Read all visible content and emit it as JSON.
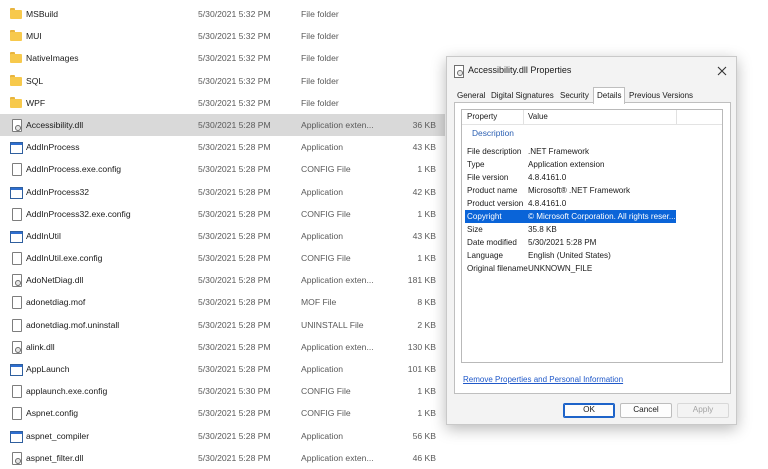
{
  "files": [
    {
      "icon": "folder-icon",
      "name": "MSBuild",
      "date": "5/30/2021 5:32 PM",
      "type": "File folder",
      "size": ""
    },
    {
      "icon": "folder-icon",
      "name": "MUI",
      "date": "5/30/2021 5:32 PM",
      "type": "File folder",
      "size": ""
    },
    {
      "icon": "folder-icon",
      "name": "NativeImages",
      "date": "5/30/2021 5:32 PM",
      "type": "File folder",
      "size": ""
    },
    {
      "icon": "folder-icon",
      "name": "SQL",
      "date": "5/30/2021 5:32 PM",
      "type": "File folder",
      "size": ""
    },
    {
      "icon": "folder-icon",
      "name": "WPF",
      "date": "5/30/2021 5:32 PM",
      "type": "File folder",
      "size": ""
    },
    {
      "icon": "dll-file-icon",
      "name": "Accessibility.dll",
      "date": "5/30/2021 5:28 PM",
      "type": "Application exten...",
      "size": "36 KB",
      "selected": true
    },
    {
      "icon": "application-icon",
      "name": "AddInProcess",
      "date": "5/30/2021 5:28 PM",
      "type": "Application",
      "size": "43 KB"
    },
    {
      "icon": "file-icon",
      "name": "AddInProcess.exe.config",
      "date": "5/30/2021 5:28 PM",
      "type": "CONFIG File",
      "size": "1 KB"
    },
    {
      "icon": "application-icon",
      "name": "AddInProcess32",
      "date": "5/30/2021 5:28 PM",
      "type": "Application",
      "size": "42 KB"
    },
    {
      "icon": "file-icon",
      "name": "AddInProcess32.exe.config",
      "date": "5/30/2021 5:28 PM",
      "type": "CONFIG File",
      "size": "1 KB"
    },
    {
      "icon": "application-icon",
      "name": "AddInUtil",
      "date": "5/30/2021 5:28 PM",
      "type": "Application",
      "size": "43 KB"
    },
    {
      "icon": "file-icon",
      "name": "AddInUtil.exe.config",
      "date": "5/30/2021 5:28 PM",
      "type": "CONFIG File",
      "size": "1 KB"
    },
    {
      "icon": "dll-file-icon",
      "name": "AdoNetDiag.dll",
      "date": "5/30/2021 5:28 PM",
      "type": "Application exten...",
      "size": "181 KB"
    },
    {
      "icon": "file-icon",
      "name": "adonetdiag.mof",
      "date": "5/30/2021 5:28 PM",
      "type": "MOF File",
      "size": "8 KB"
    },
    {
      "icon": "file-icon",
      "name": "adonetdiag.mof.uninstall",
      "date": "5/30/2021 5:28 PM",
      "type": "UNINSTALL File",
      "size": "2 KB"
    },
    {
      "icon": "dll-file-icon",
      "name": "alink.dll",
      "date": "5/30/2021 5:28 PM",
      "type": "Application exten...",
      "size": "130 KB"
    },
    {
      "icon": "application-icon",
      "name": "AppLaunch",
      "date": "5/30/2021 5:28 PM",
      "type": "Application",
      "size": "101 KB"
    },
    {
      "icon": "file-icon",
      "name": "applaunch.exe.config",
      "date": "5/30/2021 5:30 PM",
      "type": "CONFIG File",
      "size": "1 KB"
    },
    {
      "icon": "file-icon",
      "name": "Aspnet.config",
      "date": "5/30/2021 5:28 PM",
      "type": "CONFIG File",
      "size": "1 KB"
    },
    {
      "icon": "application-icon",
      "name": "aspnet_compiler",
      "date": "5/30/2021 5:28 PM",
      "type": "Application",
      "size": "56 KB"
    },
    {
      "icon": "dll-file-icon",
      "name": "aspnet_filter.dll",
      "date": "5/30/2021 5:28 PM",
      "type": "Application exten...",
      "size": "46 KB"
    }
  ],
  "dialog": {
    "title": "Accessibility.dll Properties",
    "tabs": [
      "General",
      "Digital Signatures",
      "Security",
      "Details",
      "Previous Versions"
    ],
    "active_tab": "Details",
    "columns": {
      "property": "Property",
      "value": "Value"
    },
    "group": "Description",
    "properties": [
      {
        "name": "File description",
        "value": ".NET Framework"
      },
      {
        "name": "Type",
        "value": "Application extension"
      },
      {
        "name": "File version",
        "value": "4.8.4161.0"
      },
      {
        "name": "Product name",
        "value": "Microsoft® .NET Framework"
      },
      {
        "name": "Product version",
        "value": "4.8.4161.0"
      },
      {
        "name": "Copyright",
        "value": "© Microsoft Corporation.  All rights reser...",
        "selected": true
      },
      {
        "name": "Size",
        "value": "35.8 KB"
      },
      {
        "name": "Date modified",
        "value": "5/30/2021 5:28 PM"
      },
      {
        "name": "Language",
        "value": "English (United States)"
      },
      {
        "name": "Original filename",
        "value": "UNKNOWN_FILE"
      }
    ],
    "remove_link": "Remove Properties and Personal Information",
    "buttons": {
      "ok": "OK",
      "cancel": "Cancel",
      "apply": "Apply"
    }
  }
}
